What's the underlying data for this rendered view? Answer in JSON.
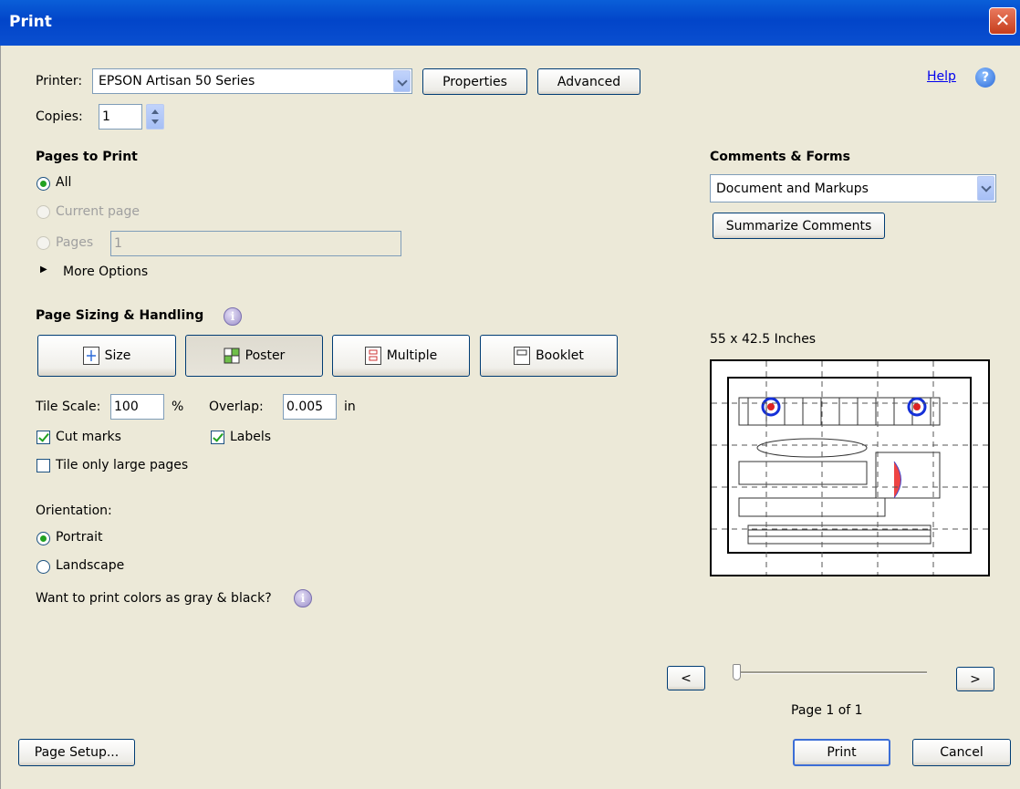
{
  "window": {
    "title": "Print",
    "close_glyph": "✕"
  },
  "printer": {
    "label": "Printer:",
    "selected": "EPSON Artisan 50 Series",
    "properties_label": "Properties",
    "advanced_label": "Advanced",
    "copies_label": "Copies:",
    "copies_value": "1"
  },
  "help": {
    "label": "Help",
    "icon": "question-icon"
  },
  "pages_to_print": {
    "heading": "Pages to Print",
    "all": "All",
    "current_page": "Current page",
    "pages": "Pages",
    "pages_value": "1",
    "more_options": "More Options",
    "selected": "All"
  },
  "comments": {
    "heading": "Comments & Forms",
    "selected": "Document and Markups",
    "summarize_label": "Summarize Comments"
  },
  "sizing": {
    "heading": "Page Sizing & Handling",
    "modes": [
      "Size",
      "Poster",
      "Multiple",
      "Booklet"
    ],
    "active_mode": "Poster",
    "tile_scale_label": "Tile Scale:",
    "tile_scale_value": "100",
    "tile_scale_unit": "%",
    "overlap_label": "Overlap:",
    "overlap_value": "0.005",
    "overlap_unit": "in",
    "cut_marks": "Cut marks",
    "cut_marks_checked": true,
    "labels": "Labels",
    "labels_checked": true,
    "tile_large": "Tile only large pages",
    "tile_large_checked": false
  },
  "orientation": {
    "label": "Orientation:",
    "portrait": "Portrait",
    "landscape": "Landscape",
    "selected": "Portrait"
  },
  "gray_question": "Want to print colors as gray & black?",
  "preview": {
    "size_text": "55 x 42.5 Inches",
    "prev_label": "<",
    "next_label": ">",
    "page_text": "Page 1 of 1"
  },
  "footer": {
    "page_setup_label": "Page Setup...",
    "print_label": "Print",
    "cancel_label": "Cancel"
  }
}
